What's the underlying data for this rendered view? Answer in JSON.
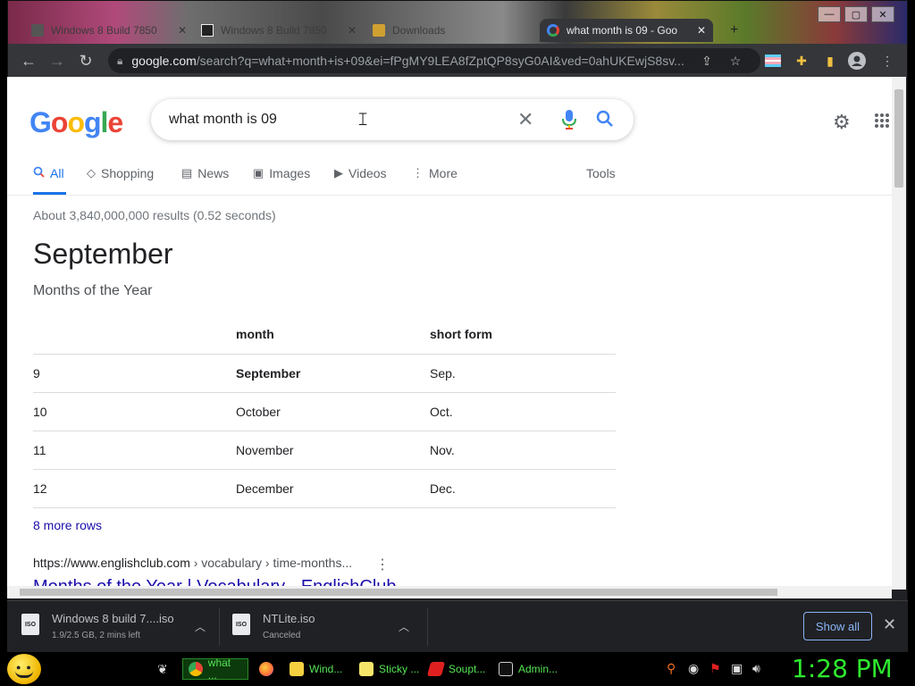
{
  "browser": {
    "tabs": [
      {
        "title": "Windows 8 Build 7850",
        "active": false
      },
      {
        "title": "Windows 8 Build 7850",
        "active": false
      },
      {
        "title": "Downloads",
        "active": false
      },
      {
        "title": "what month is 09 - Goo",
        "active": true
      }
    ],
    "new_tab_symbol": "+",
    "window_controls": [
      "—",
      "▢",
      "✕"
    ],
    "url_host": "google.com",
    "url_path": "/search?q=what+month+is+09&ei=fPgMY9LEA8fZptQP8syG0AI&ved=0ahUKEwjS8sv..."
  },
  "google": {
    "logo": [
      "G",
      "o",
      "o",
      "g",
      "l",
      "e"
    ],
    "logo_colors": [
      "#4285f4",
      "#ea4335",
      "#fbbc05",
      "#4285f4",
      "#34a853",
      "#ea4335"
    ],
    "query": "what month is 09",
    "nav_tabs": [
      {
        "label": "All",
        "icon": "search-icon"
      },
      {
        "label": "Shopping",
        "icon": "tag-icon"
      },
      {
        "label": "News",
        "icon": "newspaper-icon"
      },
      {
        "label": "Images",
        "icon": "image-icon"
      },
      {
        "label": "Videos",
        "icon": "play-icon"
      },
      {
        "label": "More",
        "icon": "more-vert-icon"
      }
    ],
    "tools": "Tools",
    "result_stats": "About 3,840,000,000 results (0.52 seconds)",
    "answer": "September",
    "answer_subtitle": "Months of the Year",
    "table": {
      "headers": [
        "",
        "month",
        "short form"
      ],
      "rows": [
        [
          "9",
          "September",
          "Sep."
        ],
        [
          "10",
          "October",
          "Oct."
        ],
        [
          "11",
          "November",
          "Nov."
        ],
        [
          "12",
          "December",
          "Dec."
        ]
      ]
    },
    "more_rows": "8 more rows",
    "cite_url": "https://www.englishclub.com",
    "cite_crumbs": " › vocabulary › time-months...",
    "result_title": "Months of the Year | Vocabulary - EnglishClub"
  },
  "downloads": [
    {
      "name": "Windows 8 build 7....iso",
      "status": "1.9/2.5 GB, 2 mins left",
      "icon": "iso-file-icon"
    },
    {
      "name": "NTLite.iso",
      "status": "Canceled",
      "icon": "iso-file-icon"
    }
  ],
  "show_all": "Show all",
  "taskbar": {
    "apps": [
      {
        "label": "what ...",
        "color": "#4285f4",
        "active": true
      },
      {
        "label": "",
        "color": "#ff7139",
        "active": false
      },
      {
        "label": "Wind...",
        "color": "#f5d142",
        "active": false
      },
      {
        "label": "Sticky ...",
        "color": "#f5e66a",
        "active": false
      },
      {
        "label": "Soupt...",
        "color": "#e02020",
        "active": false
      },
      {
        "label": "Admin...",
        "color": "#cfcfcf",
        "active": false
      }
    ],
    "clock": "1:28 PM"
  },
  "colors": {
    "accent_blue": "#1a73e8",
    "link": "#1a0dab",
    "taskbar_green": "#2ee82e"
  }
}
